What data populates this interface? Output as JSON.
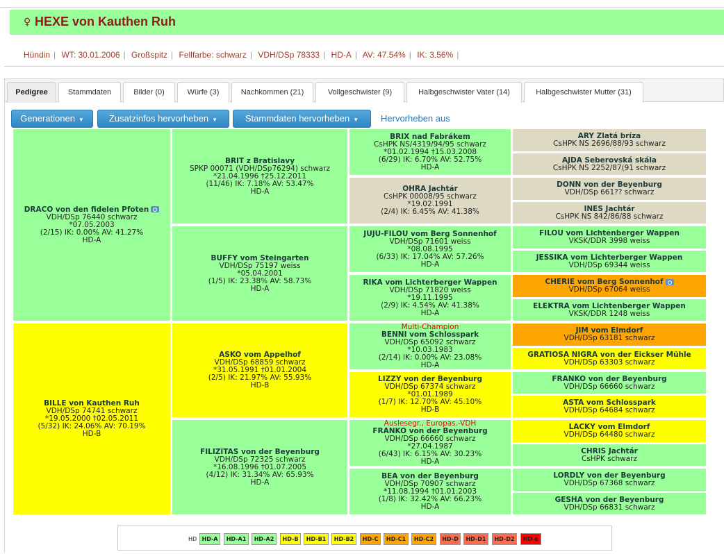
{
  "header": {
    "gender_symbol": "♀",
    "dog_name": "HEXE von Kauthen Ruh"
  },
  "info": [
    "Hündin",
    "WT: 30.01.2006",
    "Großspitz",
    "Fellfarbe: schwarz",
    "VDH/DSp 78333",
    "HD-A",
    "AV: 47.54%",
    "IK: 3.56%"
  ],
  "tabs": [
    "Pedigree",
    "Stammdaten",
    "Bilder (0)",
    "Würfe (3)",
    "Nachkommen (21)",
    "Vollgeschwister (9)",
    "Halbgeschwister Vater (14)",
    "Halbgeschwister Mutter (31)"
  ],
  "buttons": {
    "generations": "Generationen",
    "extra_info": "Zusatzinfos hervorheben",
    "master_data": "Stammdaten hervorheben",
    "highlight_off": "Hervorheben aus"
  },
  "pedigree": {
    "g1": [
      {
        "name": "DRACO von den fidelen Pfoten",
        "reg": "VDH/DSp 76440 schwarz",
        "dates": "*07.05.2003",
        "stats": "(2/15) IK: 0.00% AV: 41.27%",
        "hd": "HD-A"
      },
      {
        "name": "BILLE von Kauthen Ruh",
        "reg": "VDH/DSp 74741 schwarz",
        "dates": "*19.05.2000 †02.05.2011",
        "stats": "(5/32) IK: 24.06% AV: 70.19%",
        "hd": "HD-B"
      }
    ],
    "g2": [
      {
        "name": "BRIT z Bratislavy",
        "reg": "SPKP 00071 (VDH/DSp76294) schwarz",
        "dates": "*21.04.1996 †25.12.2011",
        "stats": "(11/46) IK: 7.18% AV: 53.47%",
        "hd": "HD-A"
      },
      {
        "name": "BUFFY vom Steingarten",
        "reg": "VDH/DSp 75197 weiss",
        "dates": "*05.04.2001",
        "stats": "(1/5) IK: 23.38% AV: 58.73%",
        "hd": "HD-A"
      },
      {
        "name": "ASKO vom Appelhof",
        "reg": "VDH/DSp 68859 schwarz",
        "dates": "*31.05.1991 †01.01.2004",
        "stats": "(2/5) IK: 21.97% AV: 55.93%",
        "hd": "HD-B"
      },
      {
        "name": "FILIZITAS von der Beyenburg",
        "reg": "VDH/DSp 72325 schwarz",
        "dates": "*16.08.1996 †01.07.2005",
        "stats": "(4/12) IK: 31.34% AV: 65.93%",
        "hd": "HD-A"
      }
    ],
    "g3": [
      {
        "title": "",
        "name": "BRIX nad Fabrákem",
        "reg": "CsHPK NS/4319/94/95 schwarz",
        "dates": "*01.02.1994 †15.03.2008",
        "stats": "(6/29) IK: 6.70% AV: 52.75%",
        "hd": "HD-A"
      },
      {
        "title": "",
        "name": "OHRA Jachtár",
        "reg": "CsHPK 00008/95 schwarz",
        "dates": "*19.02.1991",
        "stats": "(2/4) IK: 6.45% AV: 41.38%",
        "hd": ""
      },
      {
        "title": "",
        "name": "JUJU-FILOU vom Berg Sonnenhof",
        "reg": "VDH/DSp 71601 weiss",
        "dates": "*08.08.1995",
        "stats": "(6/33) IK: 17.04% AV: 57.26%",
        "hd": "HD-A"
      },
      {
        "title": "",
        "name": "RIKA vom Lichterberger Wappen",
        "reg": "VDH/DSp 71820 weiss",
        "dates": "*19.11.1995",
        "stats": "(2/9) IK: 4.54% AV: 41.38%",
        "hd": "HD-A"
      },
      {
        "title": "Multi-Champion",
        "name": "BENNI vom Schlosspark",
        "reg": "VDH/DSp 65092 schwarz",
        "dates": "*10.03.1983",
        "stats": "(2/14) IK: 0.00% AV: 23.08%",
        "hd": "HD-A"
      },
      {
        "title": "",
        "name": "LIZZY von der Beyenburg",
        "reg": "VDH/DSp 67374 schwarz",
        "dates": "*01.01.1989",
        "stats": "(1/7) IK: 12.70% AV: 45.10%",
        "hd": "HD-B"
      },
      {
        "title": "Auslesegr., Europas.-VDH",
        "name": "FRANKO von der Beyenburg",
        "reg": "VDH/DSp 66660 schwarz",
        "dates": "*27.04.1987",
        "stats": "(6/43) IK: 6.15% AV: 30.23%",
        "hd": "HD-A"
      },
      {
        "title": "",
        "name": "BEA von der Beyenburg",
        "reg": "VDH/DSp 70907 schwarz",
        "dates": "*11.08.1994 †01.01.2003",
        "stats": "(1/8) IK: 32.42% AV: 66.23%",
        "hd": "HD-A"
      }
    ],
    "g4": [
      {
        "name": "ARY Zlatá bríza",
        "reg": "CsHPK NS 2696/88/93 schwarz"
      },
      {
        "name": "AJDA Seberovská skála",
        "reg": "CsHPK NS 2252/87(91 schwarz"
      },
      {
        "name": "DONN von der Beyenburg",
        "reg": "VDH/DSp 661?? schwarz"
      },
      {
        "name": "INES Jachtár",
        "reg": "CsHPK NS 842/86/88 schwarz"
      },
      {
        "name": "FILOU vom Lichtenberger Wappen",
        "reg": "VKSK/DDR 3998 weiss"
      },
      {
        "name": "JESSIKA vom Lichterberger Wappen",
        "reg": "VDH/DSp 69344 weiss"
      },
      {
        "name": "CHERIE vom Berg Sonnenhof",
        "reg": "VDH/DSp 67064 weiss"
      },
      {
        "name": "ELEKTRA vom Lichtenberger Wappen",
        "reg": "VKSK/DDR 1248 weiss"
      },
      {
        "name": "JIM vom Elmdorf",
        "reg": "VDH/DSp 63181 schwarz"
      },
      {
        "name": "GRATIOSA NIGRA von der Eickser Mühle",
        "reg": "VDH/DSp 63303 schwarz"
      },
      {
        "name": "FRANKO von der Beyenburg",
        "reg": "VDH/DSp 66660 schwarz"
      },
      {
        "name": "ASTA vom Schlosspark",
        "reg": "VDH/DSp 64684 schwarz"
      },
      {
        "name": "LACKY vom Elmdorf",
        "reg": "VDH/DSp 64480 schwarz"
      },
      {
        "name": "CHRIS Jachtár",
        "reg": "CsHPK schwarz"
      },
      {
        "name": "LORDLY von der Beyenburg",
        "reg": "VDH/DSp 67368 schwarz"
      },
      {
        "name": "GESHA von der Beyenburg",
        "reg": "VDH/DSp 66831 schwarz"
      }
    ]
  },
  "colors": {
    "hd_a": "#99ff99",
    "hd_b": "#ffff00",
    "hd_c": "#ffa500",
    "hd_d": "#ff6a4d",
    "hd_e": "#ff0000",
    "unknown": "#ddd9c3"
  },
  "legend": {
    "label": "HD",
    "items": [
      "HD-A",
      "HD-A1",
      "HD-A2",
      "HD-B",
      "HD-B1",
      "HD-B2",
      "HD-C",
      "HD-C1",
      "HD-C2",
      "HD-D",
      "HD-D1",
      "HD-D2",
      "HD-E"
    ]
  }
}
